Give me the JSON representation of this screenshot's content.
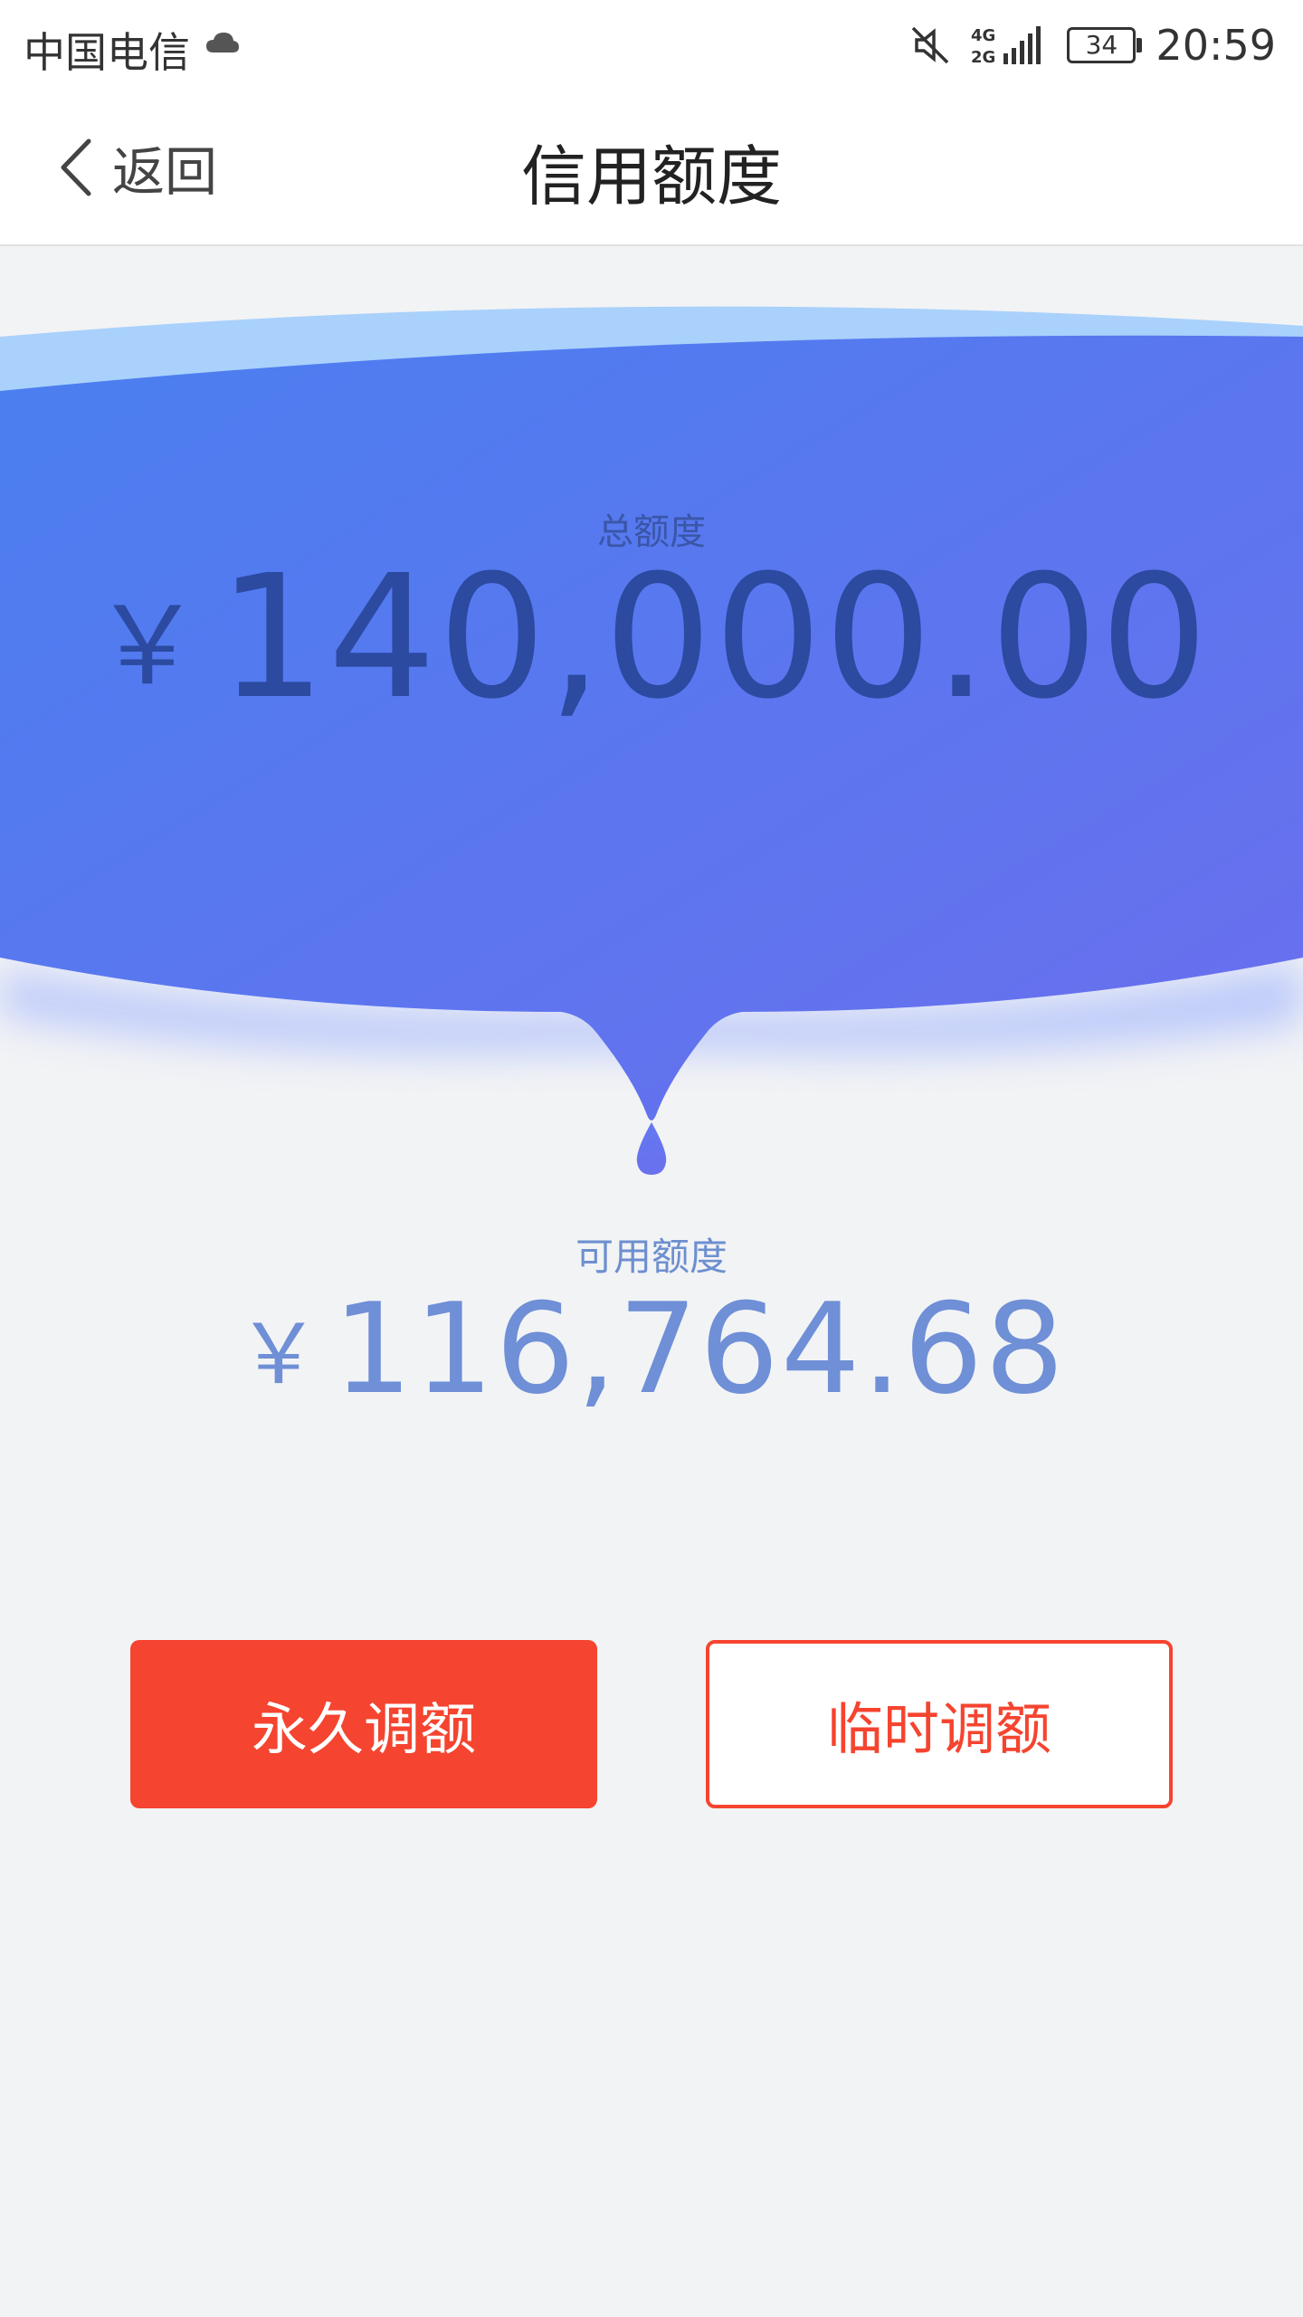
{
  "status_bar": {
    "carrier": "中国电信",
    "battery": "34",
    "time": "20:59",
    "icons": [
      "cloud-icon",
      "mute-icon",
      "signal-4g-2g-icon",
      "battery-icon"
    ]
  },
  "nav": {
    "back_label": "返回",
    "title": "信用额度"
  },
  "credit": {
    "total_label": "总额度",
    "currency_symbol": "￥",
    "total_amount": "140,000.00",
    "available_label": "可用额度",
    "available_amount": "116,764.68"
  },
  "actions": {
    "permanent_label": "永久调额",
    "temporary_label": "临时调额"
  },
  "colors": {
    "accent_red": "#f5442f",
    "gradient_start": "#4a7ff0",
    "gradient_end": "#6b6eee",
    "total_text": "#2b4aa0",
    "available_text": "#6f8fd6"
  }
}
